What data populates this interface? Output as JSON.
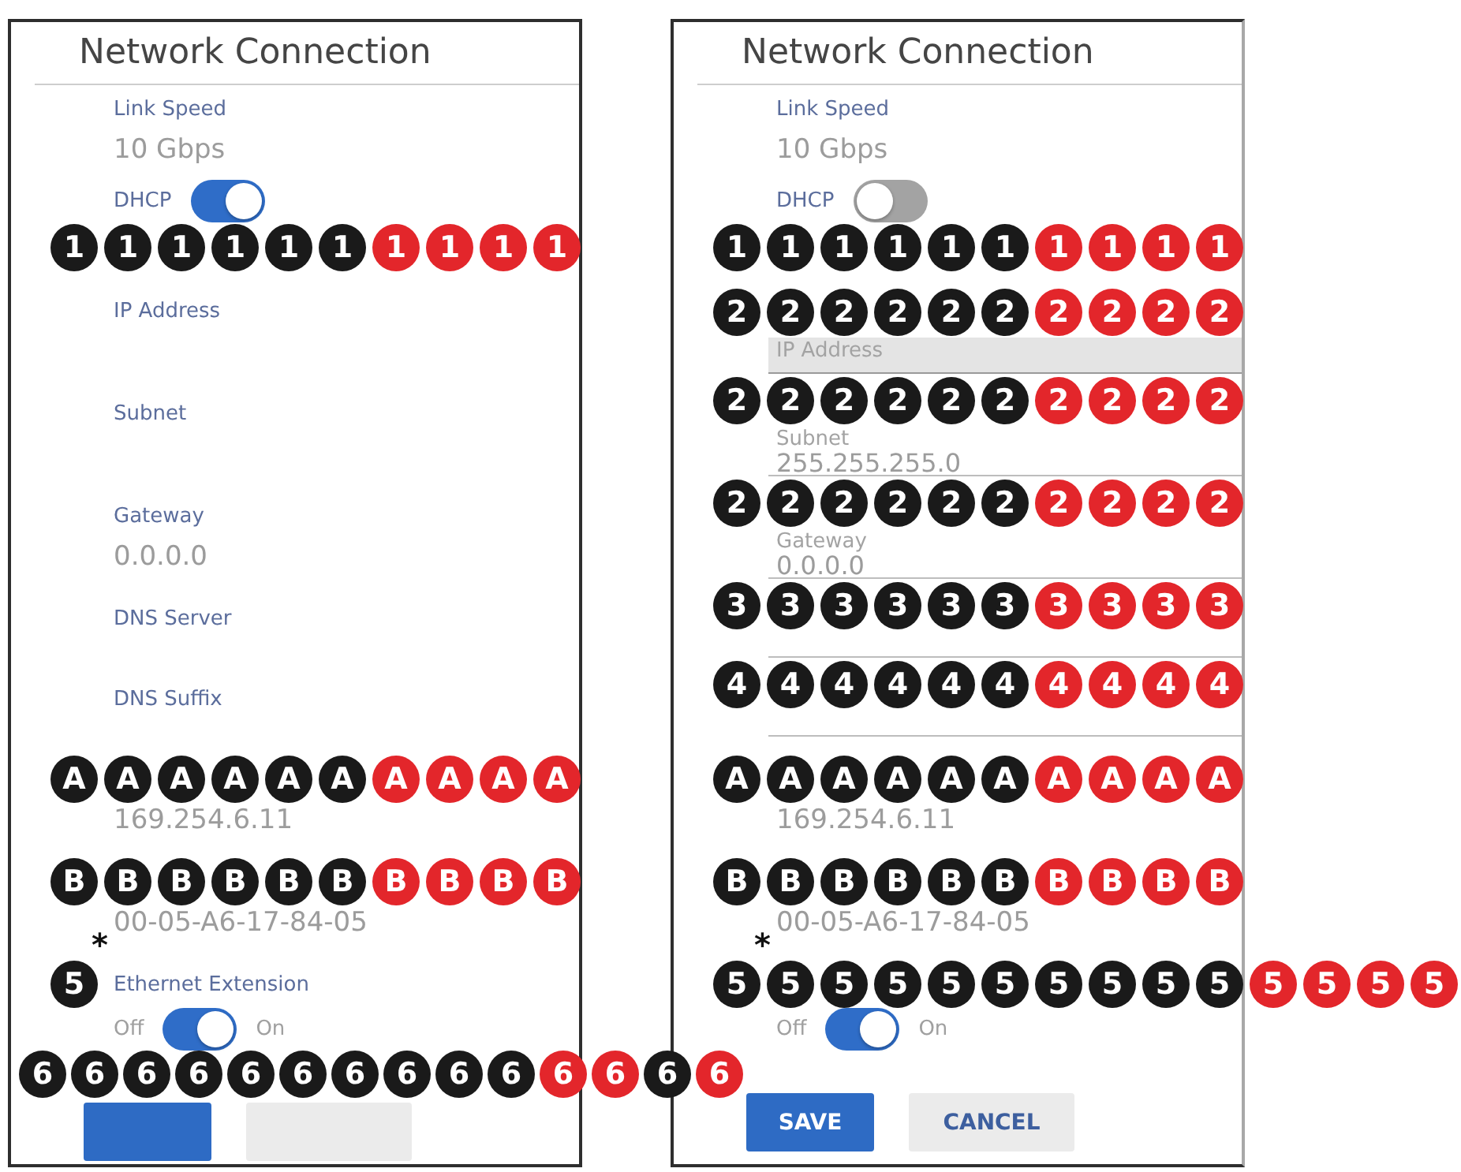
{
  "panels": [
    {
      "title": "Network Connection",
      "items": [
        {
          "kind": "readout",
          "label": "Link Speed",
          "value": "10 Gbps"
        },
        {
          "kind": "toggle",
          "label": "DHCP",
          "on": true,
          "callouts": {
            "badges": [
              {
                "label": "1",
                "color": "#1a1a1a"
              },
              {
                "label": "1",
                "color": "#1a1a1a"
              },
              {
                "label": "1",
                "color": "#1a1a1a"
              },
              {
                "label": "1",
                "color": "#1a1a1a"
              },
              {
                "label": "1",
                "color": "#1a1a1a"
              },
              {
                "label": "1",
                "color": "#1a1a1a"
              },
              {
                "label": "1",
                "color": "#e3262b"
              },
              {
                "label": "1",
                "color": "#e3262b"
              },
              {
                "label": "1",
                "color": "#e3262b"
              },
              {
                "label": "1",
                "color": "#e3262b"
              }
            ]
          }
        },
        {
          "kind": "readout",
          "label": "IP Address"
        },
        {
          "kind": "readout",
          "label": "Subnet"
        },
        {
          "kind": "readout",
          "label": "Gateway",
          "value": "0.0.0.0"
        },
        {
          "kind": "caption",
          "label": "DNS Server"
        },
        {
          "kind": "caption",
          "label": "DNS Suffix"
        },
        {
          "kind": "readout",
          "value": "169.254.6.11",
          "callouts": {
            "badges": [
              {
                "label": "A",
                "color": "#1a1a1a"
              },
              {
                "label": "A",
                "color": "#1a1a1a"
              },
              {
                "label": "A",
                "color": "#1a1a1a"
              },
              {
                "label": "A",
                "color": "#1a1a1a"
              },
              {
                "label": "A",
                "color": "#1a1a1a"
              },
              {
                "label": "A",
                "color": "#1a1a1a"
              },
              {
                "label": "A",
                "color": "#e3262b"
              },
              {
                "label": "A",
                "color": "#e3262b"
              },
              {
                "label": "A",
                "color": "#e3262b"
              },
              {
                "label": "A",
                "color": "#e3262b"
              }
            ]
          }
        },
        {
          "kind": "readout",
          "value": "00-05-A6-17-84-05",
          "callouts": {
            "badges": [
              {
                "label": "B",
                "color": "#1a1a1a"
              },
              {
                "label": "B",
                "color": "#1a1a1a"
              },
              {
                "label": "B",
                "color": "#1a1a1a"
              },
              {
                "label": "B",
                "color": "#1a1a1a"
              },
              {
                "label": "B",
                "color": "#1a1a1a"
              },
              {
                "label": "B",
                "color": "#1a1a1a"
              },
              {
                "label": "B",
                "color": "#e3262b"
              },
              {
                "label": "B",
                "color": "#e3262b"
              },
              {
                "label": "B",
                "color": "#e3262b"
              },
              {
                "label": "B",
                "color": "#e3262b"
              }
            ]
          }
        },
        {
          "kind": "switch",
          "label": "Ethernet Extension",
          "off_label": "Off",
          "on_label": "On",
          "on": true,
          "callouts": {
            "note": "*",
            "badges": [
              {
                "label": "5",
                "color": "#1a1a1a"
              }
            ]
          }
        }
      ],
      "button_callouts": {
        "badges": [
          {
            "label": "6",
            "color": "#1a1a1a"
          },
          {
            "label": "6",
            "color": "#1a1a1a"
          },
          {
            "label": "6",
            "color": "#1a1a1a"
          },
          {
            "label": "6",
            "color": "#1a1a1a"
          },
          {
            "label": "6",
            "color": "#1a1a1a"
          },
          {
            "label": "6",
            "color": "#1a1a1a"
          },
          {
            "label": "6",
            "color": "#1a1a1a"
          },
          {
            "label": "6",
            "color": "#1a1a1a"
          },
          {
            "label": "6",
            "color": "#1a1a1a"
          },
          {
            "label": "6",
            "color": "#1a1a1a"
          },
          {
            "label": "6",
            "color": "#e3262b"
          },
          {
            "label": "6",
            "color": "#e3262b"
          },
          {
            "label": "6",
            "color": "#1a1a1a"
          },
          {
            "label": "6",
            "color": "#e3262b"
          }
        ]
      },
      "buttons": [
        {
          "kind": "primary"
        },
        {
          "kind": "secondary"
        }
      ]
    },
    {
      "title": "Network Connection",
      "items": [
        {
          "kind": "readout",
          "label": "Link Speed",
          "value": "10 Gbps"
        },
        {
          "kind": "toggle",
          "label": "DHCP",
          "on": false,
          "callouts": {
            "badges": [
              {
                "label": "1",
                "color": "#1a1a1a"
              },
              {
                "label": "1",
                "color": "#1a1a1a"
              },
              {
                "label": "1",
                "color": "#1a1a1a"
              },
              {
                "label": "1",
                "color": "#1a1a1a"
              },
              {
                "label": "1",
                "color": "#1a1a1a"
              },
              {
                "label": "1",
                "color": "#1a1a1a"
              },
              {
                "label": "1",
                "color": "#e3262b"
              },
              {
                "label": "1",
                "color": "#e3262b"
              },
              {
                "label": "1",
                "color": "#e3262b"
              },
              {
                "label": "1",
                "color": "#e3262b"
              }
            ]
          }
        },
        {
          "kind": "input",
          "label": "IP Address",
          "highlighted": true,
          "callouts": {
            "badges": [
              {
                "label": "2",
                "color": "#1a1a1a"
              },
              {
                "label": "2",
                "color": "#1a1a1a"
              },
              {
                "label": "2",
                "color": "#1a1a1a"
              },
              {
                "label": "2",
                "color": "#1a1a1a"
              },
              {
                "label": "2",
                "color": "#1a1a1a"
              },
              {
                "label": "2",
                "color": "#1a1a1a"
              },
              {
                "label": "2",
                "color": "#e3262b"
              },
              {
                "label": "2",
                "color": "#e3262b"
              },
              {
                "label": "2",
                "color": "#e3262b"
              },
              {
                "label": "2",
                "color": "#e3262b"
              }
            ]
          }
        },
        {
          "kind": "input",
          "label": "Subnet",
          "value": "255.255.255.0",
          "highlighted": false,
          "callouts": {
            "badges": [
              {
                "label": "2",
                "color": "#1a1a1a"
              },
              {
                "label": "2",
                "color": "#1a1a1a"
              },
              {
                "label": "2",
                "color": "#1a1a1a"
              },
              {
                "label": "2",
                "color": "#1a1a1a"
              },
              {
                "label": "2",
                "color": "#1a1a1a"
              },
              {
                "label": "2",
                "color": "#1a1a1a"
              },
              {
                "label": "2",
                "color": "#e3262b"
              },
              {
                "label": "2",
                "color": "#e3262b"
              },
              {
                "label": "2",
                "color": "#e3262b"
              },
              {
                "label": "2",
                "color": "#e3262b"
              }
            ]
          }
        },
        {
          "kind": "input",
          "label": "Gateway",
          "value": "0.0.0.0",
          "highlighted": false,
          "callouts": {
            "badges": [
              {
                "label": "2",
                "color": "#1a1a1a"
              },
              {
                "label": "2",
                "color": "#1a1a1a"
              },
              {
                "label": "2",
                "color": "#1a1a1a"
              },
              {
                "label": "2",
                "color": "#1a1a1a"
              },
              {
                "label": "2",
                "color": "#1a1a1a"
              },
              {
                "label": "2",
                "color": "#1a1a1a"
              },
              {
                "label": "2",
                "color": "#e3262b"
              },
              {
                "label": "2",
                "color": "#e3262b"
              },
              {
                "label": "2",
                "color": "#e3262b"
              },
              {
                "label": "2",
                "color": "#e3262b"
              }
            ]
          }
        },
        {
          "kind": "input",
          "highlighted": false,
          "callouts": {
            "badges": [
              {
                "label": "3",
                "color": "#1a1a1a"
              },
              {
                "label": "3",
                "color": "#1a1a1a"
              },
              {
                "label": "3",
                "color": "#1a1a1a"
              },
              {
                "label": "3",
                "color": "#1a1a1a"
              },
              {
                "label": "3",
                "color": "#1a1a1a"
              },
              {
                "label": "3",
                "color": "#1a1a1a"
              },
              {
                "label": "3",
                "color": "#e3262b"
              },
              {
                "label": "3",
                "color": "#e3262b"
              },
              {
                "label": "3",
                "color": "#e3262b"
              },
              {
                "label": "3",
                "color": "#e3262b"
              }
            ]
          }
        },
        {
          "kind": "input",
          "highlighted": false,
          "callouts": {
            "badges": [
              {
                "label": "4",
                "color": "#1a1a1a"
              },
              {
                "label": "4",
                "color": "#1a1a1a"
              },
              {
                "label": "4",
                "color": "#1a1a1a"
              },
              {
                "label": "4",
                "color": "#1a1a1a"
              },
              {
                "label": "4",
                "color": "#1a1a1a"
              },
              {
                "label": "4",
                "color": "#1a1a1a"
              },
              {
                "label": "4",
                "color": "#e3262b"
              },
              {
                "label": "4",
                "color": "#e3262b"
              },
              {
                "label": "4",
                "color": "#e3262b"
              },
              {
                "label": "4",
                "color": "#e3262b"
              }
            ]
          }
        },
        {
          "kind": "readout",
          "value": "169.254.6.11",
          "callouts": {
            "badges": [
              {
                "label": "A",
                "color": "#1a1a1a"
              },
              {
                "label": "A",
                "color": "#1a1a1a"
              },
              {
                "label": "A",
                "color": "#1a1a1a"
              },
              {
                "label": "A",
                "color": "#1a1a1a"
              },
              {
                "label": "A",
                "color": "#1a1a1a"
              },
              {
                "label": "A",
                "color": "#1a1a1a"
              },
              {
                "label": "A",
                "color": "#e3262b"
              },
              {
                "label": "A",
                "color": "#e3262b"
              },
              {
                "label": "A",
                "color": "#e3262b"
              },
              {
                "label": "A",
                "color": "#e3262b"
              }
            ]
          }
        },
        {
          "kind": "readout",
          "value": "00-05-A6-17-84-05",
          "callouts": {
            "badges": [
              {
                "label": "B",
                "color": "#1a1a1a"
              },
              {
                "label": "B",
                "color": "#1a1a1a"
              },
              {
                "label": "B",
                "color": "#1a1a1a"
              },
              {
                "label": "B",
                "color": "#1a1a1a"
              },
              {
                "label": "B",
                "color": "#1a1a1a"
              },
              {
                "label": "B",
                "color": "#1a1a1a"
              },
              {
                "label": "B",
                "color": "#e3262b"
              },
              {
                "label": "B",
                "color": "#e3262b"
              },
              {
                "label": "B",
                "color": "#e3262b"
              },
              {
                "label": "B",
                "color": "#e3262b"
              }
            ]
          }
        },
        {
          "kind": "switch",
          "off_label": "Off",
          "on_label": "On",
          "on": true,
          "callouts": {
            "note": "*",
            "badges": [
              {
                "label": "5",
                "color": "#1a1a1a"
              },
              {
                "label": "5",
                "color": "#1a1a1a"
              },
              {
                "label": "5",
                "color": "#1a1a1a"
              },
              {
                "label": "5",
                "color": "#1a1a1a"
              },
              {
                "label": "5",
                "color": "#1a1a1a"
              },
              {
                "label": "5",
                "color": "#1a1a1a"
              },
              {
                "label": "5",
                "color": "#1a1a1a"
              },
              {
                "label": "5",
                "color": "#1a1a1a"
              },
              {
                "label": "5",
                "color": "#1a1a1a"
              },
              {
                "label": "5",
                "color": "#1a1a1a"
              },
              {
                "label": "5",
                "color": "#e3262b"
              },
              {
                "label": "5",
                "color": "#e3262b"
              },
              {
                "label": "5",
                "color": "#e3262b"
              },
              {
                "label": "5",
                "color": "#e3262b"
              }
            ]
          }
        }
      ],
      "buttons": [
        {
          "kind": "primary",
          "label": "SAVE"
        },
        {
          "kind": "secondary",
          "label": "CANCEL"
        }
      ]
    }
  ]
}
